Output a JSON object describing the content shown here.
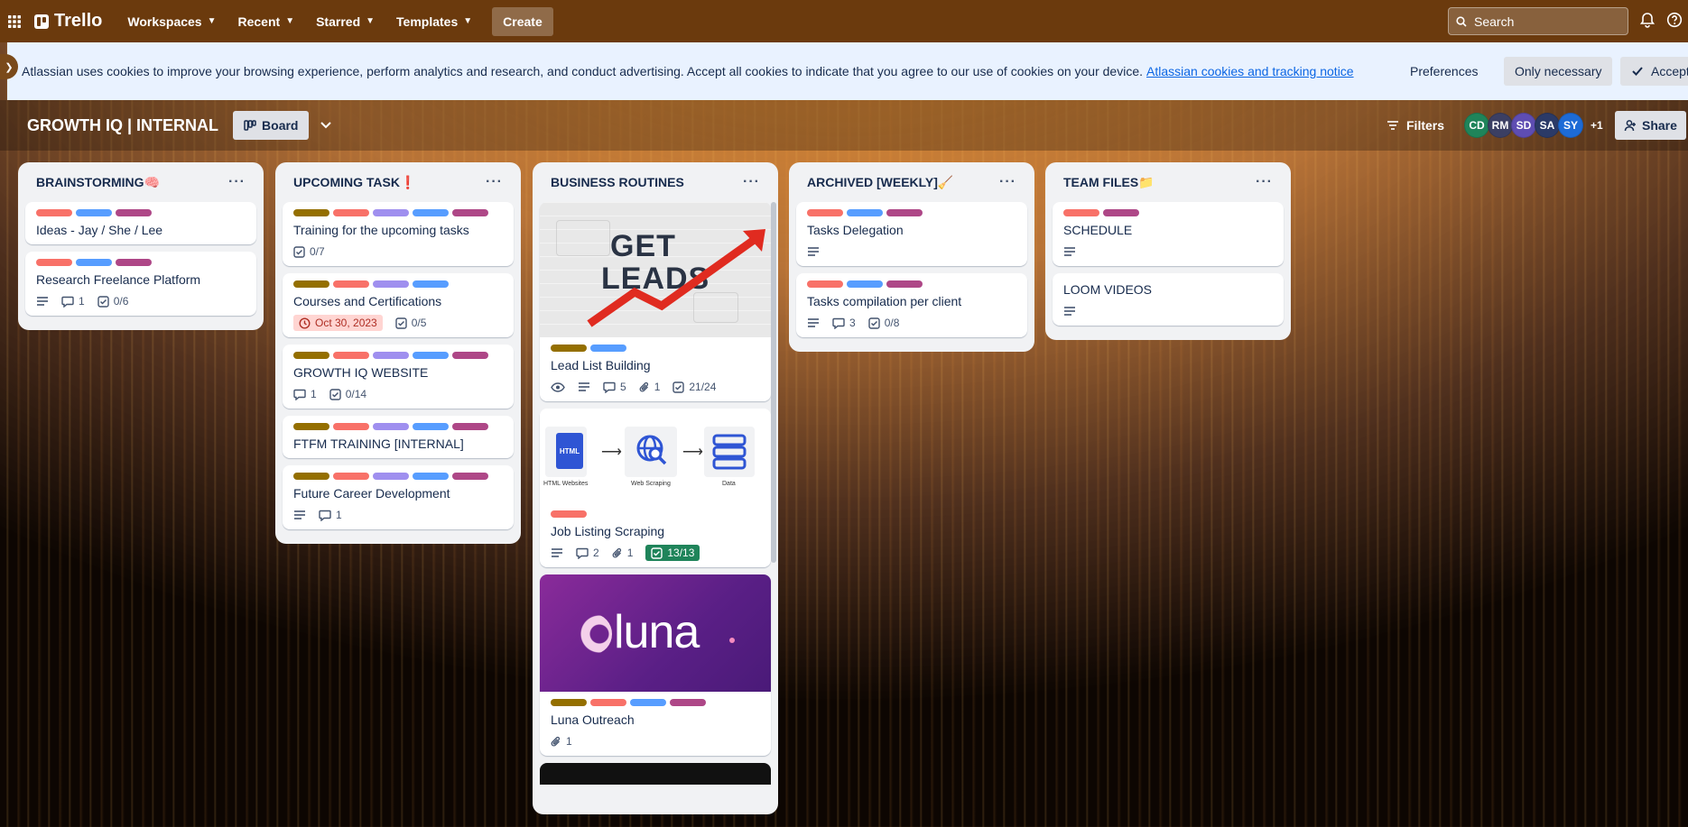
{
  "topbar": {
    "logo": "Trello",
    "nav": [
      "Workspaces",
      "Recent",
      "Starred",
      "Templates"
    ],
    "create": "Create",
    "search_placeholder": "Search"
  },
  "cookie": {
    "text": "Atlassian uses cookies to improve your browsing experience, perform analytics and research, and conduct advertising. Accept all cookies to indicate that you agree to our use of cookies on your device.",
    "link": "Atlassian cookies and tracking notice",
    "preferences": "Preferences",
    "only_necessary": "Only necessary",
    "accept": "Accept"
  },
  "board": {
    "title": "GROWTH IQ | INTERNAL",
    "view": "Board",
    "filters": "Filters",
    "members": [
      {
        "initials": "CD",
        "color": "#1f845a"
      },
      {
        "initials": "RM",
        "color": "#3b3f63"
      },
      {
        "initials": "SD",
        "color": "#5e4db2"
      },
      {
        "initials": "SA",
        "color": "#2b3a67"
      },
      {
        "initials": "SY",
        "color": "#1d6bd6"
      }
    ],
    "more_members": "+1",
    "share": "Share"
  },
  "label_colors": {
    "olive": "#946f00",
    "red": "#f87168",
    "purple": "#9f8fef",
    "blue": "#579dff",
    "magenta": "#ae4787"
  },
  "lists": [
    {
      "title": "BRAINSTORMING🧠",
      "cards": [
        {
          "labels": [
            "red",
            "blue",
            "magenta"
          ],
          "title": "Ideas - Jay / She / Lee"
        },
        {
          "labels": [
            "red",
            "blue",
            "magenta"
          ],
          "title": "Research Freelance Platform",
          "badges": [
            {
              "icon": "description",
              "text": ""
            },
            {
              "icon": "comment",
              "text": "1"
            },
            {
              "icon": "checklist",
              "text": "0/6"
            }
          ]
        }
      ]
    },
    {
      "title": "UPCOMING TASK❗",
      "cards": [
        {
          "labels": [
            "olive",
            "red",
            "purple",
            "blue",
            "magenta"
          ],
          "title": "Training for the upcoming tasks",
          "badges": [
            {
              "icon": "checklist",
              "text": "0/7"
            }
          ]
        },
        {
          "labels": [
            "olive",
            "red",
            "purple",
            "blue"
          ],
          "title": "Courses and Certifications",
          "badges": [
            {
              "icon": "clock",
              "text": "Oct 30, 2023",
              "style": "due"
            },
            {
              "icon": "checklist",
              "text": "0/5"
            }
          ]
        },
        {
          "labels": [
            "olive",
            "red",
            "purple",
            "blue",
            "magenta"
          ],
          "title": "GROWTH IQ WEBSITE",
          "badges": [
            {
              "icon": "comment",
              "text": "1"
            },
            {
              "icon": "checklist",
              "text": "0/14"
            }
          ]
        },
        {
          "labels": [
            "olive",
            "red",
            "purple",
            "blue",
            "magenta"
          ],
          "title": "FTFM TRAINING [INTERNAL]"
        },
        {
          "labels": [
            "olive",
            "red",
            "purple",
            "blue",
            "magenta"
          ],
          "title": "Future Career Development",
          "badges": [
            {
              "icon": "description",
              "text": ""
            },
            {
              "icon": "comment",
              "text": "1"
            }
          ]
        }
      ]
    },
    {
      "title": "BUSINESS ROUTINES",
      "cards": [
        {
          "cover": "leads",
          "cover_text": [
            "GET",
            "LEADS"
          ],
          "labels": [
            "olive",
            "blue"
          ],
          "title": "Lead List Building",
          "badges": [
            {
              "icon": "eye",
              "text": ""
            },
            {
              "icon": "description",
              "text": ""
            },
            {
              "icon": "comment",
              "text": "5"
            },
            {
              "icon": "attachment",
              "text": "1"
            },
            {
              "icon": "checklist",
              "text": "21/24"
            }
          ]
        },
        {
          "cover": "scraping",
          "cover_text": [
            "HTML",
            "HTML Websites",
            "Web Scraping",
            "Data"
          ],
          "labels": [
            "red"
          ],
          "title": "Job Listing Scraping",
          "badges": [
            {
              "icon": "description",
              "text": ""
            },
            {
              "icon": "comment",
              "text": "2"
            },
            {
              "icon": "attachment",
              "text": "1"
            },
            {
              "icon": "checklist",
              "text": "13/13",
              "style": "done"
            }
          ]
        },
        {
          "cover": "luna",
          "cover_text": [
            "luna"
          ],
          "labels": [
            "olive",
            "red",
            "blue",
            "magenta"
          ],
          "title": "Luna Outreach",
          "badges": [
            {
              "icon": "attachment",
              "text": "1"
            }
          ]
        }
      ]
    },
    {
      "title": "ARCHIVED [WEEKLY]🧹",
      "cards": [
        {
          "labels": [
            "red",
            "blue",
            "magenta"
          ],
          "title": "Tasks Delegation",
          "badges": [
            {
              "icon": "description",
              "text": ""
            }
          ]
        },
        {
          "labels": [
            "red",
            "blue",
            "magenta"
          ],
          "title": "Tasks compilation per client",
          "badges": [
            {
              "icon": "description",
              "text": ""
            },
            {
              "icon": "comment",
              "text": "3"
            },
            {
              "icon": "checklist",
              "text": "0/8"
            }
          ]
        }
      ]
    },
    {
      "title": "TEAM FILES📁",
      "cards": [
        {
          "labels": [
            "red",
            "magenta"
          ],
          "title": "SCHEDULE",
          "badges": [
            {
              "icon": "description",
              "text": ""
            }
          ]
        },
        {
          "title": "LOOM VIDEOS",
          "badges": [
            {
              "icon": "description",
              "text": ""
            }
          ]
        }
      ]
    }
  ]
}
